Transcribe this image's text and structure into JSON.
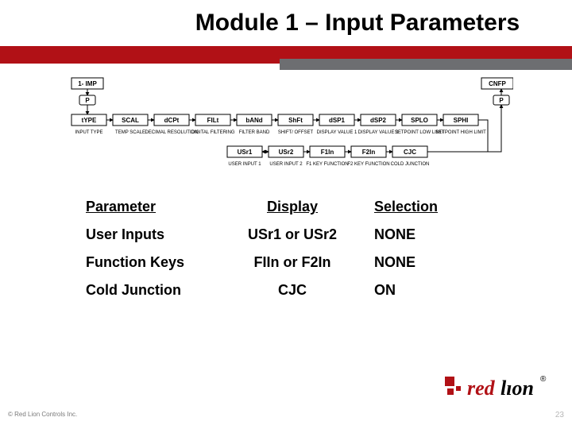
{
  "title": "Module 1 – Input Parameters",
  "diagram": {
    "entry": {
      "label": "1- IMP",
      "caption": ""
    },
    "nav": {
      "left": "P",
      "right": "P"
    },
    "exit": {
      "label": "CNFP",
      "caption": ""
    },
    "row1": [
      {
        "label": "tYPE",
        "caption": "INPUT TYPE"
      },
      {
        "label": "SCAL",
        "caption": "TEMP SCALE"
      },
      {
        "label": "dCPt",
        "caption": "DECIMAL RESOLUTION"
      },
      {
        "label": "FILt",
        "caption": "DIGITAL FILTERING"
      },
      {
        "label": "bANd",
        "caption": "FILTER BAND"
      },
      {
        "label": "ShFt",
        "caption": "SHIFT/ OFFSET"
      },
      {
        "label": "dSP1",
        "caption": "DISPLAY VALUE 1"
      },
      {
        "label": "dSP2",
        "caption": "DISPLAY VALUE 2"
      },
      {
        "label": "SPLO",
        "caption": "SETPOINT LOW LIMIT"
      },
      {
        "label": "SPHI",
        "caption": "SETPOINT HIGH LIMIT"
      }
    ],
    "row2": [
      {
        "label": "USr1",
        "caption": "USER INPUT 1"
      },
      {
        "label": "USr2",
        "caption": "USER INPUT 2"
      },
      {
        "label": "F1In",
        "caption": "F1 KEY FUNCTION"
      },
      {
        "label": "F2In",
        "caption": "F2 KEY FUNCTION"
      },
      {
        "label": "CJC",
        "caption": "COLD JUNCTION"
      }
    ]
  },
  "table": {
    "headers": {
      "param": "Parameter",
      "display": "Display",
      "selection": "Selection"
    },
    "rows": [
      {
        "param": "User Inputs",
        "display": "USr1 or USr2",
        "selection": "NONE"
      },
      {
        "param": "Function Keys",
        "display": "FIIn or F2In",
        "selection": "NONE"
      },
      {
        "param": "Cold Junction",
        "display": "CJC",
        "selection": "ON"
      }
    ]
  },
  "logo": {
    "red": "red",
    "lion": "lıon",
    "reg": "®"
  },
  "footer": {
    "copyright": "© Red Lion Controls Inc.",
    "page": "23"
  }
}
